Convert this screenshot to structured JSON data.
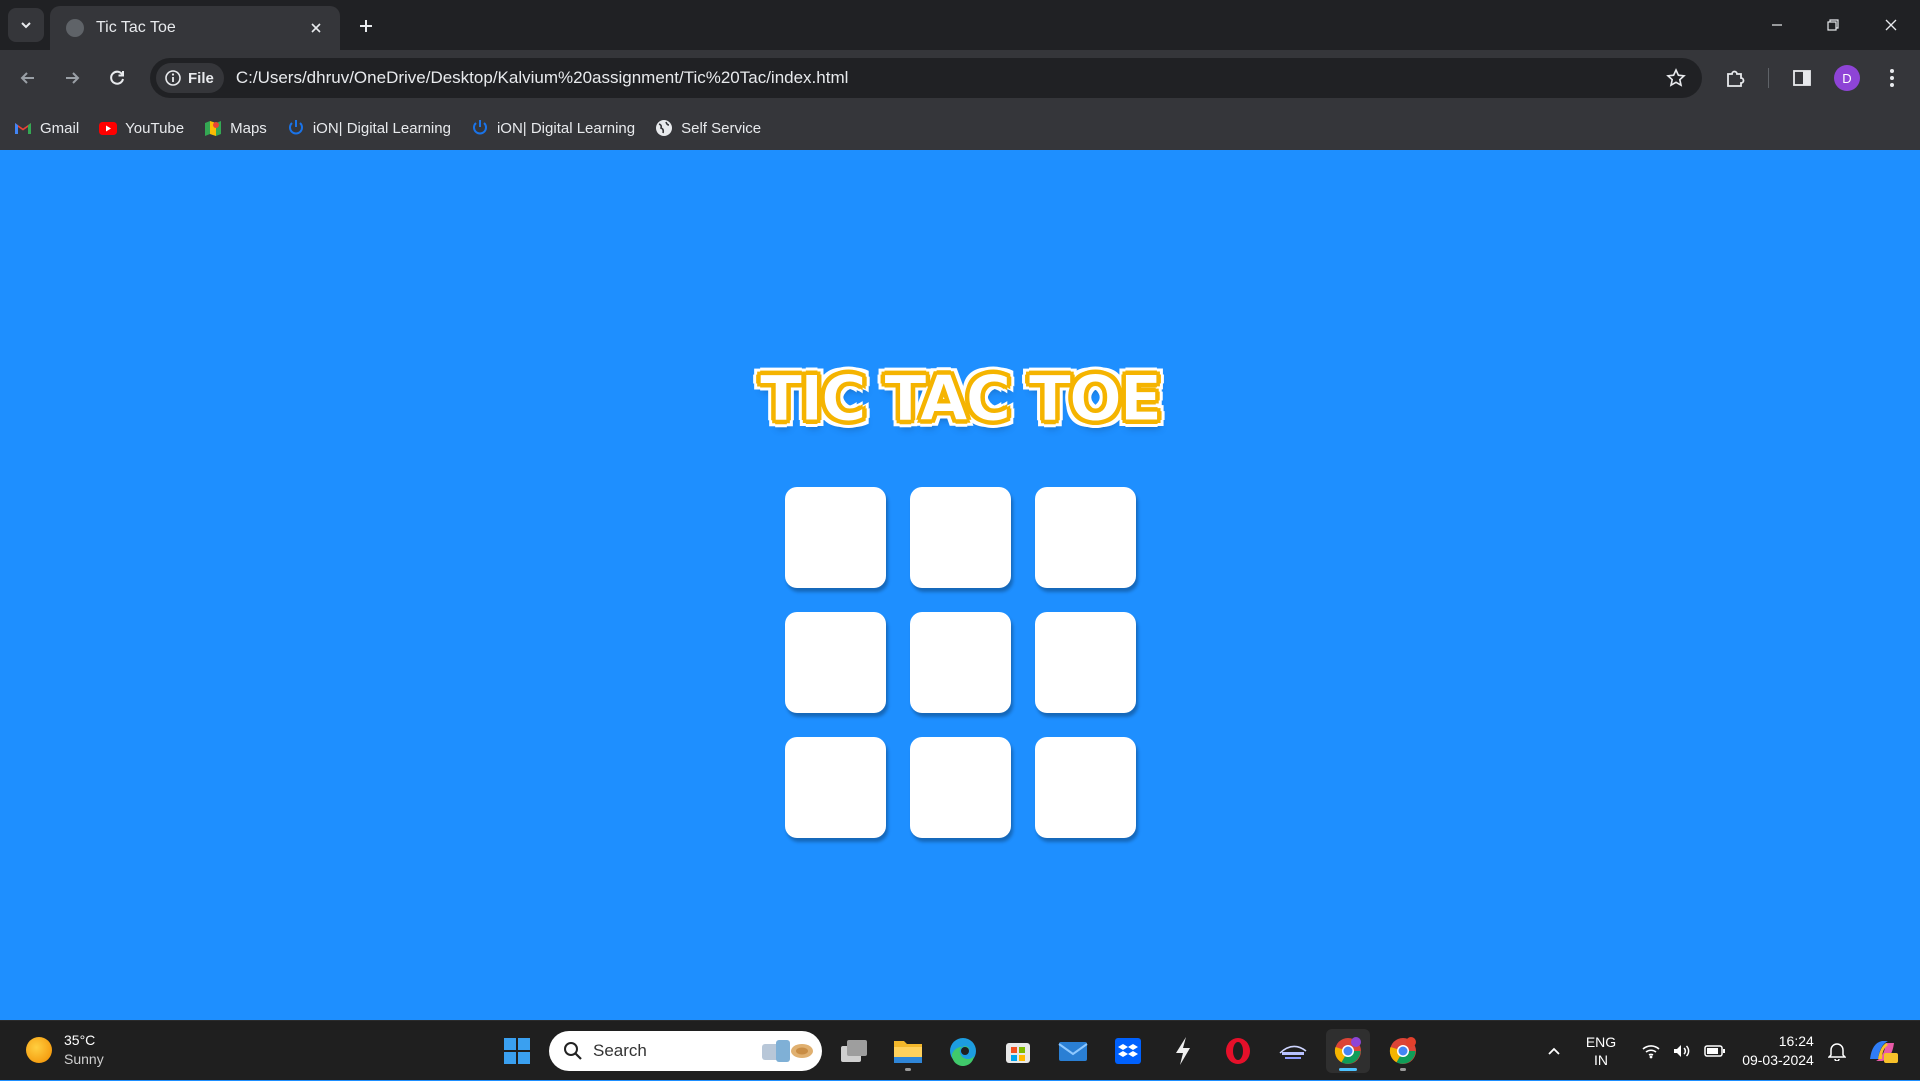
{
  "browser": {
    "tab": {
      "title": "Tic Tac Toe"
    },
    "address": {
      "chip_label": "File",
      "url": "C:/Users/dhruv/OneDrive/Desktop/Kalvium%20assignment/Tic%20Tac/index.html"
    },
    "profile_initial": "D",
    "bookmarks": [
      {
        "label": "Gmail",
        "icon": "gmail-icon"
      },
      {
        "label": "YouTube",
        "icon": "youtube-icon"
      },
      {
        "label": "Maps",
        "icon": "maps-icon"
      },
      {
        "label": "iON| Digital Learning",
        "icon": "ion-icon"
      },
      {
        "label": "iON| Digital Learning",
        "icon": "ion-icon"
      },
      {
        "label": "Self Service",
        "icon": "globe-icon"
      }
    ]
  },
  "game": {
    "title": "TIC TAC TOE",
    "board": [
      "",
      "",
      "",
      "",
      "",
      "",
      "",
      "",
      ""
    ]
  },
  "taskbar": {
    "weather": {
      "temp": "35°C",
      "condition": "Sunny"
    },
    "search_label": "Search",
    "language": {
      "line1": "ENG",
      "line2": "IN"
    },
    "clock": {
      "time": "16:24",
      "date": "09-03-2024"
    }
  },
  "colors": {
    "page_background": "#1e8fff",
    "title_outline": "#f5b400",
    "cell": "#ffffff",
    "chrome_dark": "#202124",
    "chrome": "#35363a"
  }
}
